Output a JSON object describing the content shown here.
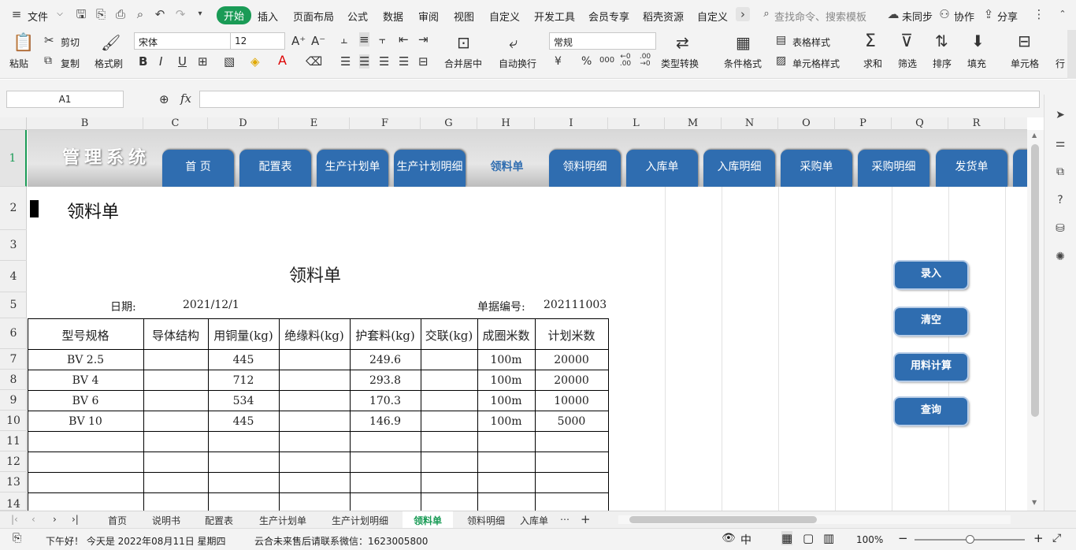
{
  "menu": {
    "file": "文件",
    "items": [
      "开始",
      "插入",
      "页面布局",
      "公式",
      "数据",
      "审阅",
      "视图",
      "自定义",
      "开发工具",
      "会员专享",
      "稻壳资源",
      "自定义"
    ],
    "search_placeholder": "查找命令、搜索模板",
    "sync": "未同步",
    "collab": "协作",
    "share": "分享"
  },
  "ribbon": {
    "paste": "粘贴",
    "cut": "剪切",
    "copy": "复制",
    "format_painter": "格式刷",
    "font_name": "宋体",
    "font_size": "12",
    "merge_center": "合并居中",
    "wrap_text": "自动换行",
    "number_format": "常规",
    "type_convert": "类型转换",
    "cond_format": "条件格式",
    "table_style": "表格样式",
    "cell_style": "单元格样式",
    "sum": "求和",
    "filter": "筛选",
    "sort": "排序",
    "fill": "填充",
    "cell": "单元格",
    "row": "行",
    "currency": "¥",
    "percent": "%",
    "thousands": "000",
    "dec_inc": "←0 .00",
    "dec_dec": ".00 →0"
  },
  "formula_bar": {
    "name_box": "A1",
    "fx": "fx",
    "value": ""
  },
  "columns": [
    "B",
    "C",
    "D",
    "E",
    "F",
    "G",
    "H",
    "I",
    "L",
    "M",
    "N",
    "O",
    "P",
    "Q",
    "R"
  ],
  "rows": [
    "1",
    "2",
    "3",
    "4",
    "5",
    "6",
    "7",
    "8",
    "9",
    "10",
    "11",
    "12",
    "13",
    "14"
  ],
  "nav": {
    "system_title": "管理系统",
    "buttons": [
      "首 页",
      "配置表",
      "生产计划单",
      "生产计划明细",
      "领料单",
      "领料明细",
      "入库单",
      "入库明细",
      "采购单",
      "采购明细",
      "发货单"
    ]
  },
  "sheet_heading": "领料单",
  "form": {
    "title": "领料单",
    "date_label": "日期:",
    "date_value": "2021/12/1",
    "doc_no_label": "单据编号:",
    "doc_no_value": "202111003",
    "headers": [
      "型号规格",
      "导体结构",
      "用铜量(kg)",
      "绝缘料(kg)",
      "护套料(kg)",
      "交联(kg)",
      "成圈米数",
      "计划米数"
    ],
    "rows": [
      [
        "BV 2.5",
        "",
        "445",
        "",
        "249.6",
        "",
        "100m",
        "20000"
      ],
      [
        "BV 4",
        "",
        "712",
        "",
        "293.8",
        "",
        "100m",
        "20000"
      ],
      [
        "BV 6",
        "",
        "534",
        "",
        "170.3",
        "",
        "100m",
        "10000"
      ],
      [
        "BV 10",
        "",
        "445",
        "",
        "146.9",
        "",
        "100m",
        "5000"
      ]
    ]
  },
  "side_buttons": [
    "录入",
    "清空",
    "用料计算",
    "查询"
  ],
  "tabs": [
    "首页",
    "说明书",
    "配置表",
    "生产计划单",
    "生产计划明细",
    "领料单",
    "领料明细",
    "入库单"
  ],
  "status": {
    "greeting": "下午好！ 今天是 2022年08月11日 星期四",
    "notice": "云合未来售后请联系微信：1623005800",
    "zoom": "100%"
  },
  "colors": {
    "accent": "#1a9b56",
    "nav_blue": "#2f6db0"
  }
}
